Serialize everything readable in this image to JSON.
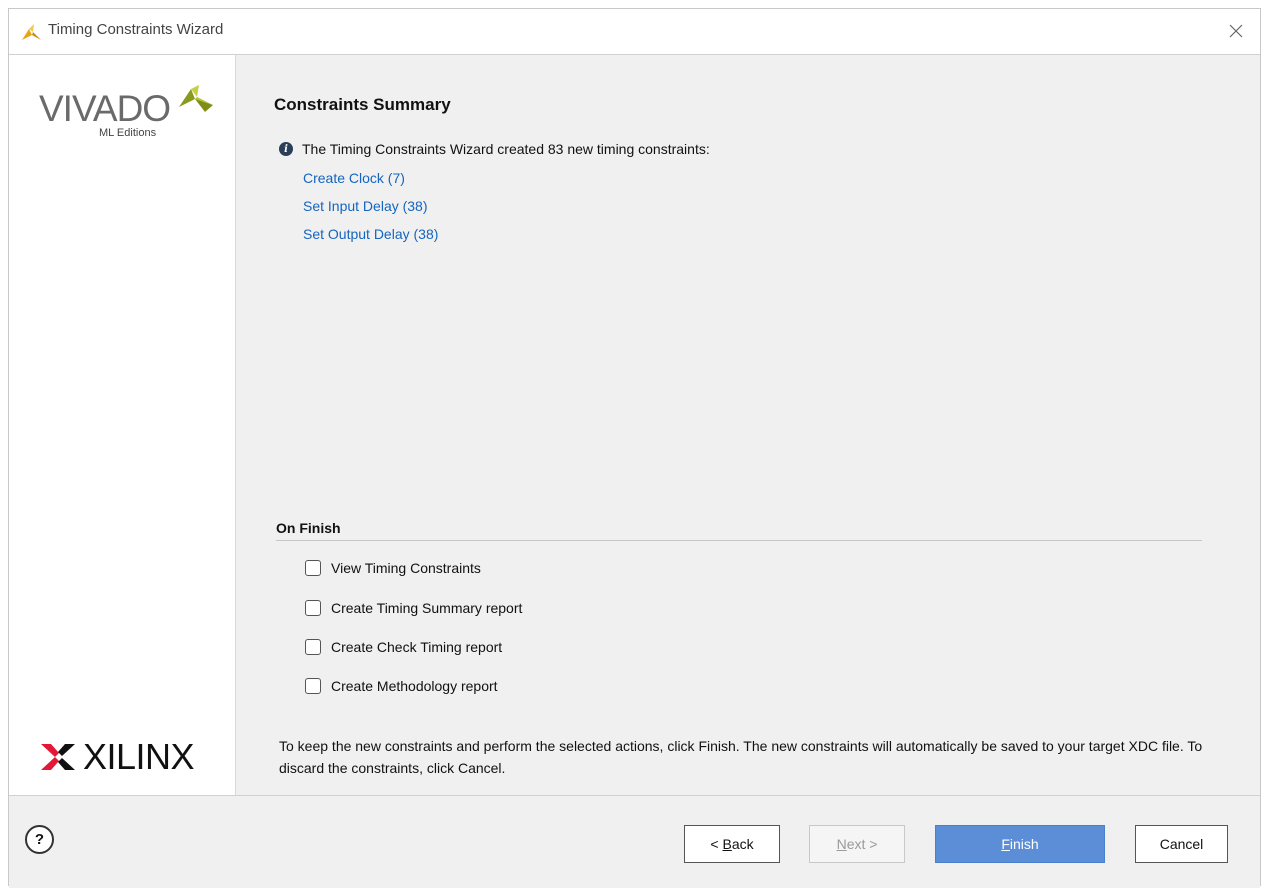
{
  "window": {
    "title": "Timing Constraints Wizard"
  },
  "sidebar": {
    "vivado_logo_text": "VIVADO",
    "vivado_logo_sub": "ML Editions",
    "xilinx_logo_text": "XILINX"
  },
  "summary": {
    "heading": "Constraints Summary",
    "info_text": "The Timing Constraints Wizard created 83 new timing constraints:",
    "links": [
      "Create Clock (7)",
      "Set Input Delay (38)",
      "Set Output Delay (38)"
    ]
  },
  "on_finish": {
    "label": "On Finish",
    "options": [
      {
        "label": "View Timing Constraints",
        "checked": false
      },
      {
        "label": "Create Timing Summary report",
        "checked": false
      },
      {
        "label": "Create Check Timing report",
        "checked": false
      },
      {
        "label": "Create Methodology report",
        "checked": false
      }
    ]
  },
  "footer_text": "To keep the new constraints and perform the selected actions, click Finish. The new constraints will automatically be saved to your target XDC file. To discard the constraints, click Cancel.",
  "buttons": {
    "help": "?",
    "back_prefix": "< ",
    "back_mnemonic": "B",
    "back_rest": "ack",
    "next_mnemonic": "N",
    "next_rest": "ext >",
    "finish_mnemonic": "F",
    "finish_rest": "inish",
    "cancel": "Cancel"
  },
  "colors": {
    "link": "#1565c0",
    "finish_button": "#5b8ed6",
    "vivado_leaf": "#a8b832",
    "xilinx_red": "#e31837"
  },
  "icons": [
    "vivado-app-icon",
    "close-icon",
    "info-icon",
    "help-icon",
    "vivado-leaf-icon",
    "xilinx-mark-icon"
  ]
}
